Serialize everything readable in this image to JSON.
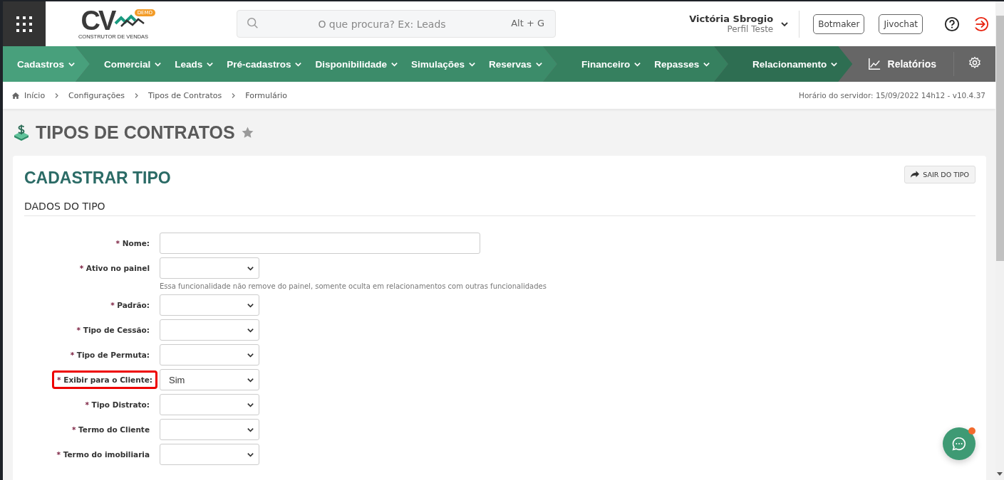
{
  "logo": {
    "text": "CV",
    "badge": "DEMO",
    "tagline": "CONSTRUTOR DE VENDAS"
  },
  "search": {
    "placeholder": "O que procura? Ex: Leads",
    "shortcut": "Alt + G"
  },
  "user": {
    "name": "Victória Sbrogio",
    "profile": "Perfil Teste"
  },
  "header_buttons": [
    "Botmaker",
    "Jivochat"
  ],
  "nav": {
    "groups": [
      {
        "color": "#48a07c",
        "items": [
          "Cadastros"
        ]
      },
      {
        "color": "#3c8c6a",
        "items": [
          "Comercial",
          "Leads",
          "Pré-cadastros",
          "Disponibilidade",
          "Simulações",
          "Reservas"
        ]
      },
      {
        "color": "#36805f",
        "items": [
          "Financeiro",
          "Repasses"
        ]
      },
      {
        "color": "#2e6e52",
        "items": [
          "Relacionamento"
        ]
      }
    ],
    "reports": "Relatórios"
  },
  "breadcrumb": [
    "Início",
    "Configurações",
    "Tipos de Contratos",
    "Formulário"
  ],
  "server_time": "Horário do servidor: 15/09/2022 14h12 - v10.4.37",
  "page_title": {
    "text": "TIPOS DE CONTRATOS",
    "favorite": false
  },
  "card": {
    "title": "CADASTRAR TIPO",
    "exit_button": "SAIR DO TIPO",
    "section": "DADOS DO TIPO",
    "fields": [
      {
        "kind": "text",
        "required_mark": "*",
        "label": "Nome:",
        "highlighted": false
      },
      {
        "kind": "select",
        "required_mark": "*",
        "label": "Ativo no painel",
        "highlighted": false,
        "hint": "Essa funcionalidade não remove do painel, somente oculta em relacionamentos com outras funcionalidades"
      },
      {
        "kind": "select",
        "required_mark": "*",
        "label": "Padrão:",
        "highlighted": false
      },
      {
        "kind": "select",
        "required_mark": "*",
        "label": "Tipo de Cessão:",
        "highlighted": false
      },
      {
        "kind": "select",
        "required_mark": "*",
        "label": "Tipo de Permuta:",
        "highlighted": false
      },
      {
        "kind": "select",
        "required_mark": "*",
        "label": "Exibir para o Cliente:",
        "highlighted": true,
        "value": "Sim"
      },
      {
        "kind": "select",
        "required_mark": "*",
        "label": "Tipo Distrato:",
        "highlighted": false
      },
      {
        "kind": "select",
        "required_mark": "*",
        "label": "Termo do Cliente",
        "highlighted": false
      },
      {
        "kind": "select",
        "required_mark": "*",
        "label": "Termo do imobiliaria",
        "highlighted": false
      }
    ]
  }
}
